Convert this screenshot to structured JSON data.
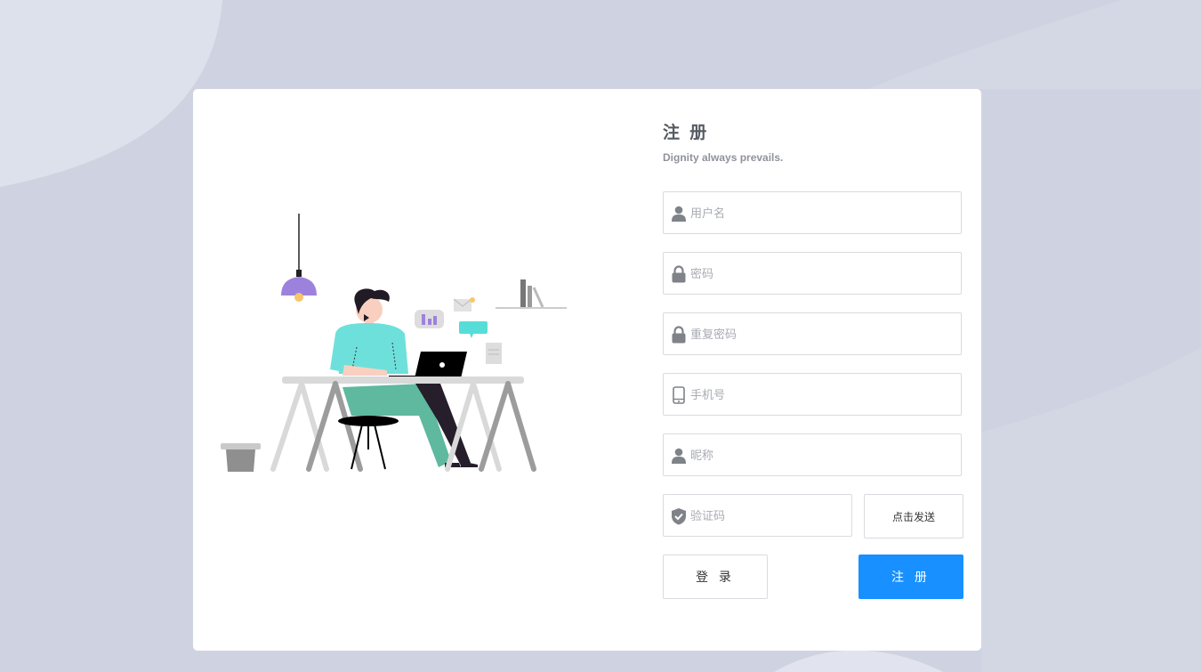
{
  "form": {
    "title": "注 册",
    "subtitle": "Dignity always prevails.",
    "fields": [
      {
        "name": "username",
        "placeholder": "用户名",
        "icon": "user-icon"
      },
      {
        "name": "password",
        "placeholder": "密码",
        "icon": "lock-icon"
      },
      {
        "name": "repeat-password",
        "placeholder": "重复密码",
        "icon": "lock-icon"
      },
      {
        "name": "phone",
        "placeholder": "手机号",
        "icon": "phone-icon"
      },
      {
        "name": "nickname",
        "placeholder": "昵称",
        "icon": "user-icon"
      },
      {
        "name": "captcha",
        "placeholder": "验证码",
        "icon": "shield-check-icon"
      }
    ],
    "send_code_label": "点击发送",
    "login_label": "登 录",
    "register_label": "注 册"
  },
  "colors": {
    "background": "#cfd3e1",
    "card": "#ffffff",
    "primary": "#1890ff",
    "icon": "#7f8289"
  }
}
